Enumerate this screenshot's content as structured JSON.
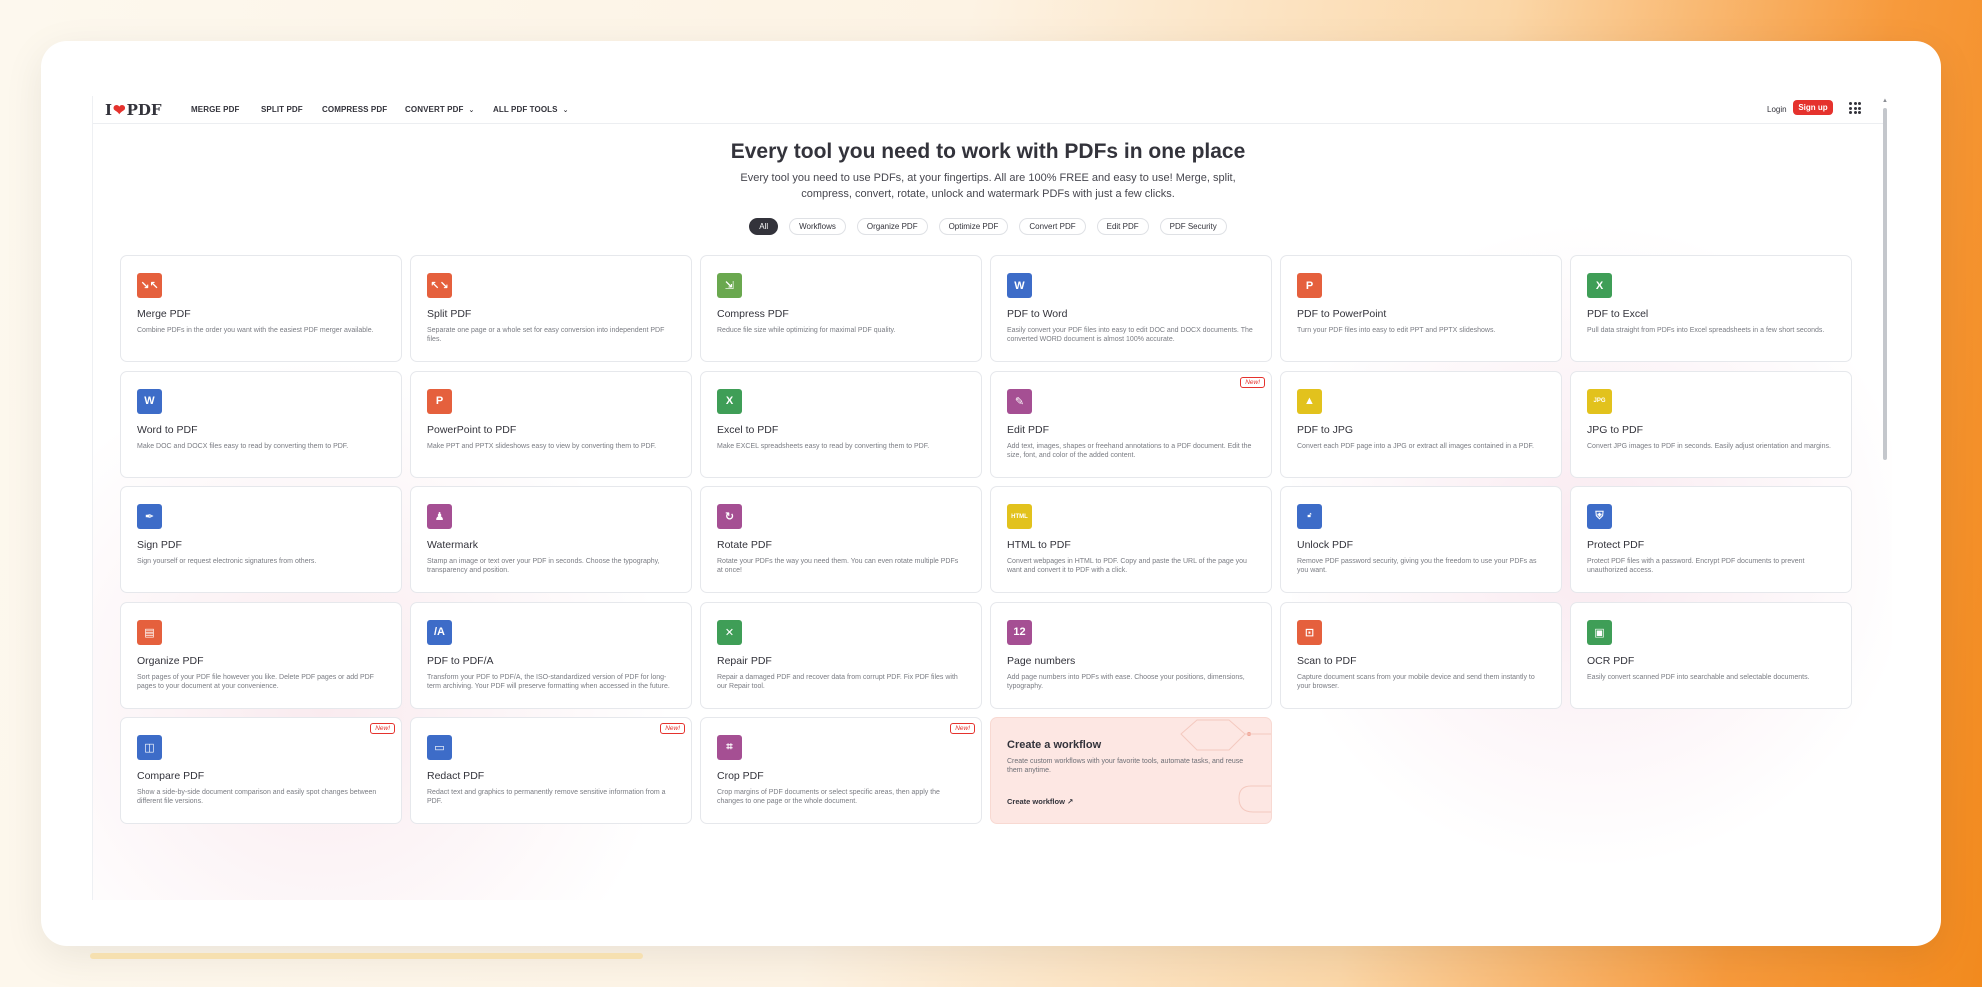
{
  "nav": {
    "logo_left": "I",
    "logo_right": "PDF",
    "items": [
      {
        "label": "MERGE PDF"
      },
      {
        "label": "SPLIT PDF"
      },
      {
        "label": "COMPRESS PDF"
      },
      {
        "label": "CONVERT PDF"
      },
      {
        "label": "ALL PDF TOOLS"
      }
    ],
    "login": "Login",
    "signup": "Sign up"
  },
  "hero": {
    "title": "Every tool you need to work with PDFs in one place",
    "subtitle": "Every tool you need to use PDFs, at your fingertips. All are 100% FREE and easy to use! Merge, split, compress, convert, rotate, unlock and watermark PDFs with just a few clicks."
  },
  "filters": [
    "All",
    "Workflows",
    "Organize PDF",
    "Optimize PDF",
    "Convert PDF",
    "Edit PDF",
    "PDF Security"
  ],
  "badge_label": "New!",
  "tools": [
    {
      "title": "Merge PDF",
      "desc": "Combine PDFs in the order you want with the easiest PDF merger available.",
      "icon": "merge-icon",
      "color": "#e5603d"
    },
    {
      "title": "Split PDF",
      "desc": "Separate one page or a whole set for easy conversion into independent PDF files.",
      "icon": "split-icon",
      "color": "#e5603d"
    },
    {
      "title": "Compress PDF",
      "desc": "Reduce file size while optimizing for maximal PDF quality.",
      "icon": "compress-icon",
      "color": "#6aa84f"
    },
    {
      "title": "PDF to Word",
      "desc": "Easily convert your PDF files into easy to edit DOC and DOCX documents. The converted WORD document is almost 100% accurate.",
      "icon": "word-icon",
      "color": "#3d6cc8"
    },
    {
      "title": "PDF to PowerPoint",
      "desc": "Turn your PDF files into easy to edit PPT and PPTX slideshows.",
      "icon": "powerpoint-icon",
      "color": "#e5603d"
    },
    {
      "title": "PDF to Excel",
      "desc": "Pull data straight from PDFs into Excel spreadsheets in a few short seconds.",
      "icon": "excel-icon",
      "color": "#3f9e57"
    },
    {
      "title": "Word to PDF",
      "desc": "Make DOC and DOCX files easy to read by converting them to PDF.",
      "icon": "word-icon",
      "color": "#3d6cc8"
    },
    {
      "title": "PowerPoint to PDF",
      "desc": "Make PPT and PPTX slideshows easy to view by converting them to PDF.",
      "icon": "powerpoint-icon",
      "color": "#e5603d"
    },
    {
      "title": "Excel to PDF",
      "desc": "Make EXCEL spreadsheets easy to read by converting them to PDF.",
      "icon": "excel-icon",
      "color": "#3f9e57"
    },
    {
      "title": "Edit PDF",
      "desc": "Add text, images, shapes or freehand annotations to a PDF document. Edit the size, font, and color of the added content.",
      "icon": "edit-icon",
      "color": "#a54f93",
      "new": true
    },
    {
      "title": "PDF to JPG",
      "desc": "Convert each PDF page into a JPG or extract all images contained in a PDF.",
      "icon": "image-icon",
      "color": "#e2c21d"
    },
    {
      "title": "JPG to PDF",
      "desc": "Convert JPG images to PDF in seconds. Easily adjust orientation and margins.",
      "icon": "jpg-icon",
      "color": "#e2c21d"
    },
    {
      "title": "Sign PDF",
      "desc": "Sign yourself or request electronic signatures from others.",
      "icon": "pen-icon",
      "color": "#3d6cc8"
    },
    {
      "title": "Watermark",
      "desc": "Stamp an image or text over your PDF in seconds. Choose the typography, transparency and position.",
      "icon": "stamp-icon",
      "color": "#a54f93"
    },
    {
      "title": "Rotate PDF",
      "desc": "Rotate your PDFs the way you need them. You can even rotate multiple PDFs at once!",
      "icon": "rotate-icon",
      "color": "#a54f93"
    },
    {
      "title": "HTML to PDF",
      "desc": "Convert webpages in HTML to PDF. Copy and paste the URL of the page you want and convert it to PDF with a click.",
      "icon": "html-icon",
      "color": "#e2c21d"
    },
    {
      "title": "Unlock PDF",
      "desc": "Remove PDF password security, giving you the freedom to use your PDFs as you want.",
      "icon": "unlock-icon",
      "color": "#3d6cc8"
    },
    {
      "title": "Protect PDF",
      "desc": "Protect PDF files with a password. Encrypt PDF documents to prevent unauthorized access.",
      "icon": "shield-icon",
      "color": "#3d6cc8"
    },
    {
      "title": "Organize PDF",
      "desc": "Sort pages of your PDF file however you like. Delete PDF pages or add PDF pages to your document at your convenience.",
      "icon": "organize-icon",
      "color": "#e5603d"
    },
    {
      "title": "PDF to PDF/A",
      "desc": "Transform your PDF to PDF/A, the ISO-standardized version of PDF for long-term archiving. Your PDF will preserve formatting when accessed in the future.",
      "icon": "pdfa-icon",
      "color": "#3d6cc8"
    },
    {
      "title": "Repair PDF",
      "desc": "Repair a damaged PDF and recover data from corrupt PDF. Fix PDF files with our Repair tool.",
      "icon": "repair-icon",
      "color": "#3f9e57"
    },
    {
      "title": "Page numbers",
      "desc": "Add page numbers into PDFs with ease. Choose your positions, dimensions, typography.",
      "icon": "page-numbers-icon",
      "color": "#a54f93"
    },
    {
      "title": "Scan to PDF",
      "desc": "Capture document scans from your mobile device and send them instantly to your browser.",
      "icon": "scan-icon",
      "color": "#e5603d"
    },
    {
      "title": "OCR PDF",
      "desc": "Easily convert scanned PDF into searchable and selectable documents.",
      "icon": "ocr-icon",
      "color": "#3f9e57"
    },
    {
      "title": "Compare PDF",
      "desc": "Show a side-by-side document comparison and easily spot changes between different file versions.",
      "icon": "compare-icon",
      "color": "#3d6cc8",
      "new": true
    },
    {
      "title": "Redact PDF",
      "desc": "Redact text and graphics to permanently remove sensitive information from a PDF.",
      "icon": "redact-icon",
      "color": "#3d6cc8",
      "new": true
    },
    {
      "title": "Crop PDF",
      "desc": "Crop margins of PDF documents or select specific areas, then apply the changes to one page or the whole document.",
      "icon": "crop-icon",
      "color": "#a54f93",
      "new": true
    }
  ],
  "workflow": {
    "title": "Create a workflow",
    "desc": "Create custom workflows with your favorite tools, automate tasks, and reuse them anytime.",
    "link": "Create workflow"
  }
}
